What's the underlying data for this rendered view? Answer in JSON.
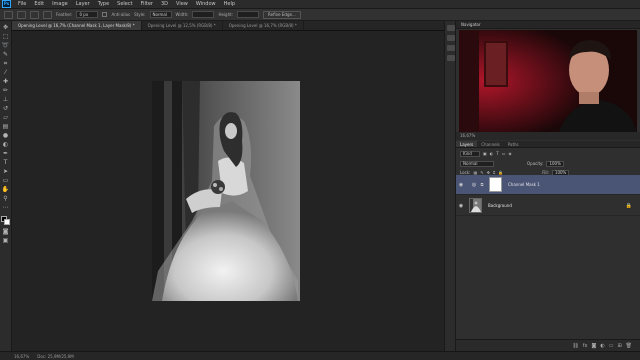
{
  "app": {
    "logo": "Ps"
  },
  "menu": [
    "File",
    "Edit",
    "Image",
    "Layer",
    "Type",
    "Select",
    "Filter",
    "3D",
    "View",
    "Window",
    "Help"
  ],
  "options": {
    "feather_label": "Feather:",
    "feather_value": "0 px",
    "antialias_label": "Anti-alias",
    "style_label": "Style:",
    "style_value": "Normal",
    "width_label": "Width:",
    "height_label": "Height:",
    "refine_button": "Refine Edge..."
  },
  "tabs": [
    "Opening Level @ 16,7% (Channel Mask 1, Layer Mask/8) *",
    "Opening Level @ 12,5% (RGB/8) *",
    "Opening Level @ 16,7% (RGB/8) *"
  ],
  "tools": [
    "move-icon",
    "marquee-icon",
    "lasso-icon",
    "quick-select-icon",
    "crop-icon",
    "eyedropper-icon",
    "healing-icon",
    "brush-icon",
    "clone-stamp-icon",
    "history-brush-icon",
    "eraser-icon",
    "gradient-icon",
    "blur-icon",
    "dodge-icon",
    "pen-icon",
    "type-icon",
    "path-select-icon",
    "shape-icon",
    "hand-icon",
    "zoom-icon"
  ],
  "navigator": {
    "title": "Navigator",
    "zoom": "16,67%"
  },
  "layers_panel": {
    "tabs": [
      "Layers",
      "Channels",
      "Paths"
    ],
    "kind_label": "Kind",
    "blend_mode": "Normal",
    "opacity_label": "Opacity:",
    "opacity_value": "100%",
    "lock_label": "Lock:",
    "fill_label": "Fill:",
    "fill_value": "100%",
    "layers": [
      {
        "name": "Channel Mask 1",
        "selected": true
      },
      {
        "name": "Background",
        "selected": false
      }
    ]
  },
  "status": {
    "zoom": "16,67%",
    "doc": "Doc: 25,9M/25,9M"
  },
  "colors": {
    "accent": "#31a8ff",
    "selection": "#4a5475"
  }
}
